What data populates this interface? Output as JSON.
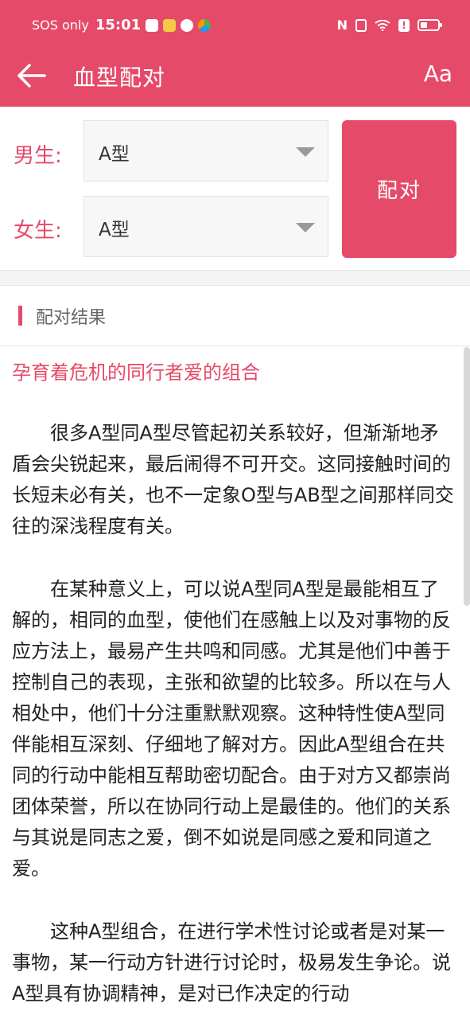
{
  "status_bar": {
    "sos": "SOS only",
    "time": "15:01"
  },
  "app_bar": {
    "title": "血型配对",
    "font_button": "Aa",
    "background_color": "#e64a69"
  },
  "form": {
    "male_label": "男生:",
    "female_label": "女生:",
    "male_value": "A型",
    "female_value": "A型",
    "pair_button": "配对"
  },
  "result": {
    "section_title": "配对结果",
    "heading": "孕育着危机的同行者爱的组合",
    "paragraphs": [
      "很多A型同A型尽管起初关系较好，但渐渐地矛盾会尖锐起来，最后闹得不可开交。这同接触时间的长短未必有关，也不一定象O型与AB型之间那样同交往的深浅程度有关。",
      "在某种意义上，可以说A型同A型是最能相互了解的，相同的血型，使他们在感触上以及对事物的反应方法上，最易产生共鸣和同感。尤其是他们中善于控制自己的表现，主张和欲望的比较多。所以在与人相处中，他们十分注重默默观察。这种特性使A型同伴能相互深刻、仔细地了解对方。因此A型组合在共同的行动中能相互帮助密切配合。由于对方又都崇尚团体荣誉，所以在协同行动上是最佳的。他们的关系与其说是同志之爱，倒不如说是同感之爱和同道之爱。",
      "这种A型组合，在进行学术性讨论或者是对某一事物，某一行动方针进行讨论时，极易发生争论。说A型具有协调精神，是对已作决定的行动"
    ]
  }
}
